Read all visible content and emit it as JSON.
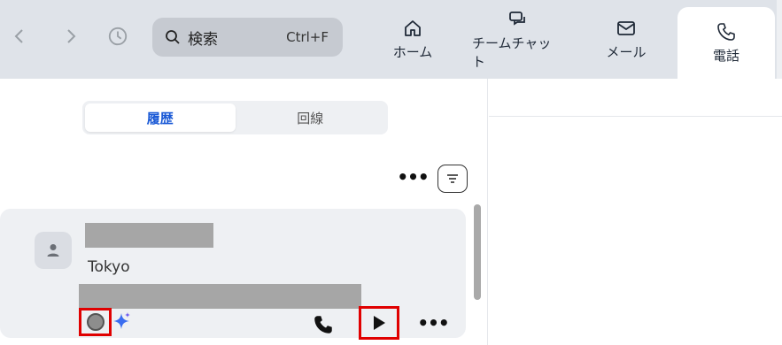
{
  "topbar": {
    "search": {
      "label": "検索",
      "shortcut": "Ctrl+F"
    },
    "tabs": [
      {
        "label": "ホーム",
        "icon": "home-icon"
      },
      {
        "label": "チームチャット",
        "icon": "chat-icon"
      },
      {
        "label": "メール",
        "icon": "mail-icon"
      },
      {
        "label": "電話",
        "icon": "phone-icon",
        "active": true
      }
    ]
  },
  "segments": [
    {
      "label": "履歴",
      "active": true
    },
    {
      "label": "回線",
      "active": false
    }
  ],
  "more_label": "•••",
  "call_card": {
    "location": "Tokyo",
    "more_label": "•••"
  },
  "colors": {
    "accent": "#1b5ad6",
    "highlight": "#e00000",
    "topbar": "#dfe3e9",
    "card": "#eef0f3"
  }
}
